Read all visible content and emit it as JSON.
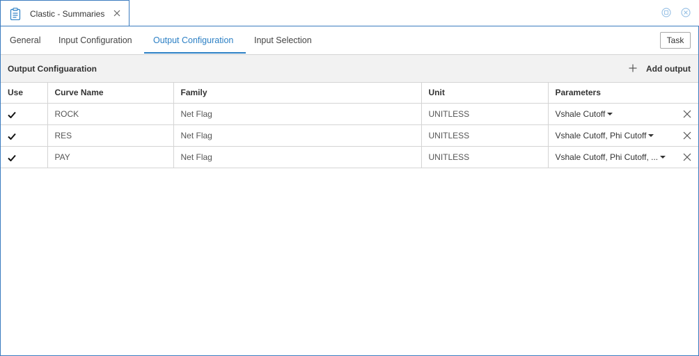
{
  "window": {
    "tab_title": "Clastic - Summaries"
  },
  "subtabs": [
    {
      "label": "General",
      "active": false
    },
    {
      "label": "Input Configuration",
      "active": false
    },
    {
      "label": "Output Configuration",
      "active": true
    },
    {
      "label": "Input Selection",
      "active": false
    }
  ],
  "toolbar": {
    "task_label": "Task"
  },
  "section": {
    "title": "Output Configuaration",
    "add_label": "Add output"
  },
  "table": {
    "headers": [
      "Use",
      "Curve Name",
      "Family",
      "Unit",
      "Parameters"
    ],
    "rows": [
      {
        "use": true,
        "curve": "ROCK",
        "family": "Net Flag",
        "unit": "UNITLESS",
        "parameters": "Vshale Cutoff"
      },
      {
        "use": true,
        "curve": "RES",
        "family": "Net Flag",
        "unit": "UNITLESS",
        "parameters": "Vshale Cutoff, Phi Cutoff"
      },
      {
        "use": true,
        "curve": "PAY",
        "family": "Net Flag",
        "unit": "UNITLESS",
        "parameters": "Vshale Cutoff, Phi Cutoff, ..."
      }
    ]
  },
  "colors": {
    "accent": "#2b7fc4",
    "border": "#3a7bbf",
    "header_bg": "#f2f2f2"
  }
}
